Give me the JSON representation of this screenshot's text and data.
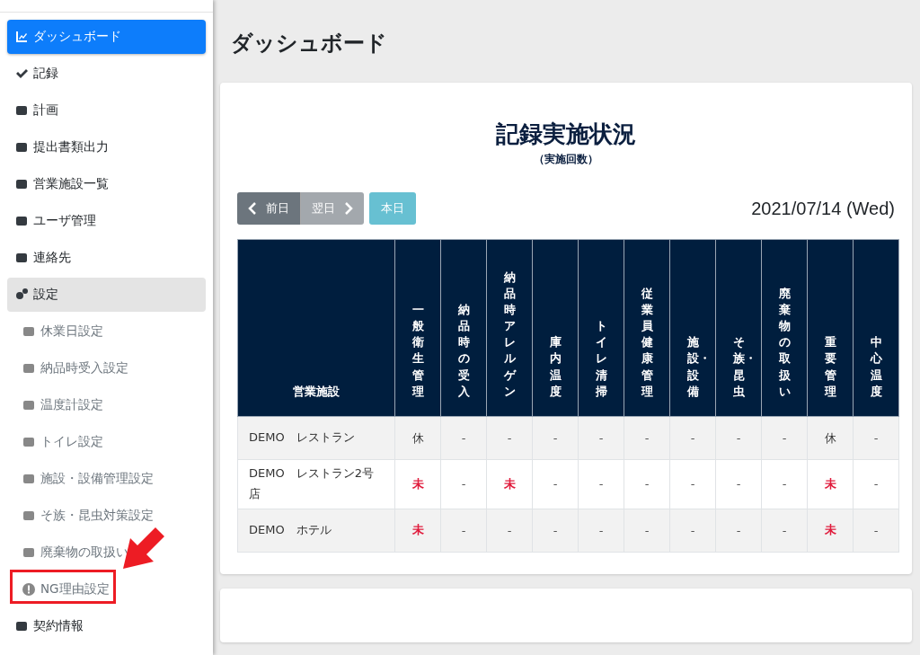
{
  "sidebar": {
    "items": [
      {
        "label": "ダッシュボード",
        "kind": "main",
        "selected": true,
        "open": false,
        "annotated": false
      },
      {
        "label": "記録",
        "kind": "main",
        "selected": false,
        "open": false,
        "annotated": false
      },
      {
        "label": "計画",
        "kind": "main",
        "selected": false,
        "open": false,
        "annotated": false
      },
      {
        "label": "提出書類出力",
        "kind": "main",
        "selected": false,
        "open": false,
        "annotated": false
      },
      {
        "label": "営業施設一覧",
        "kind": "main",
        "selected": false,
        "open": false,
        "annotated": false
      },
      {
        "label": "ユーザ管理",
        "kind": "main",
        "selected": false,
        "open": false,
        "annotated": false
      },
      {
        "label": "連絡先",
        "kind": "main",
        "selected": false,
        "open": false,
        "annotated": false
      },
      {
        "label": "設定",
        "kind": "main",
        "selected": false,
        "open": true,
        "annotated": false
      },
      {
        "label": "休業日設定",
        "kind": "sub",
        "selected": false,
        "open": false,
        "annotated": false
      },
      {
        "label": "納品時受入設定",
        "kind": "sub",
        "selected": false,
        "open": false,
        "annotated": false
      },
      {
        "label": "温度計設定",
        "kind": "sub",
        "selected": false,
        "open": false,
        "annotated": false
      },
      {
        "label": "トイレ設定",
        "kind": "sub",
        "selected": false,
        "open": false,
        "annotated": false
      },
      {
        "label": "施設・設備管理設定",
        "kind": "sub",
        "selected": false,
        "open": false,
        "annotated": false
      },
      {
        "label": "そ族・昆虫対策設定",
        "kind": "sub",
        "selected": false,
        "open": false,
        "annotated": false
      },
      {
        "label": "廃棄物の取扱い",
        "kind": "sub",
        "selected": false,
        "open": false,
        "annotated": false
      },
      {
        "label": "NG理由設定",
        "kind": "sub",
        "selected": false,
        "open": false,
        "annotated": true
      },
      {
        "label": "契約情報",
        "kind": "main",
        "selected": false,
        "open": false,
        "annotated": false
      }
    ]
  },
  "page_title": "ダッシュボード",
  "card": {
    "title": "記録実施状況",
    "subtitle": "（実施回数）",
    "nav_buttons": [
      {
        "label": "前日",
        "kind": "prev",
        "disabled": false
      },
      {
        "label": "翌日",
        "kind": "next",
        "disabled": true
      },
      {
        "label": "本日",
        "kind": "today",
        "disabled": false
      }
    ],
    "date": "2021/07/14 (Wed)",
    "table": {
      "columns": [
        "営業施設",
        "一般衛生管理",
        "納品時の受入",
        "納品時アレルゲン",
        "庫内温度",
        "トイレ清掃",
        "従業員健康管理",
        "施設・設備",
        "そ族・昆虫",
        "廃棄物の取扱い",
        "重要管理",
        "中心温度"
      ],
      "rows": [
        {
          "cells": [
            {
              "text": "DEMO　レストラン",
              "kind": "name"
            },
            {
              "text": "休",
              "kind": "holiday"
            },
            {
              "text": "-",
              "kind": "none"
            },
            {
              "text": "-",
              "kind": "none"
            },
            {
              "text": "-",
              "kind": "none"
            },
            {
              "text": "-",
              "kind": "none"
            },
            {
              "text": "-",
              "kind": "none"
            },
            {
              "text": "-",
              "kind": "none"
            },
            {
              "text": "-",
              "kind": "none"
            },
            {
              "text": "-",
              "kind": "none"
            },
            {
              "text": "休",
              "kind": "holiday"
            },
            {
              "text": "-",
              "kind": "none"
            }
          ]
        },
        {
          "cells": [
            {
              "text": "DEMO　レストラン2号店",
              "kind": "name"
            },
            {
              "text": "未",
              "kind": "pending"
            },
            {
              "text": "-",
              "kind": "none"
            },
            {
              "text": "未",
              "kind": "pending"
            },
            {
              "text": "-",
              "kind": "none"
            },
            {
              "text": "-",
              "kind": "none"
            },
            {
              "text": "-",
              "kind": "none"
            },
            {
              "text": "-",
              "kind": "none"
            },
            {
              "text": "-",
              "kind": "none"
            },
            {
              "text": "-",
              "kind": "none"
            },
            {
              "text": "未",
              "kind": "pending"
            },
            {
              "text": "-",
              "kind": "none"
            }
          ]
        },
        {
          "cells": [
            {
              "text": "DEMO　ホテル",
              "kind": "name"
            },
            {
              "text": "未",
              "kind": "pending"
            },
            {
              "text": "-",
              "kind": "none"
            },
            {
              "text": "-",
              "kind": "none"
            },
            {
              "text": "-",
              "kind": "none"
            },
            {
              "text": "-",
              "kind": "none"
            },
            {
              "text": "-",
              "kind": "none"
            },
            {
              "text": "-",
              "kind": "none"
            },
            {
              "text": "-",
              "kind": "none"
            },
            {
              "text": "-",
              "kind": "none"
            },
            {
              "text": "未",
              "kind": "pending"
            },
            {
              "text": "-",
              "kind": "none"
            }
          ]
        }
      ]
    }
  }
}
